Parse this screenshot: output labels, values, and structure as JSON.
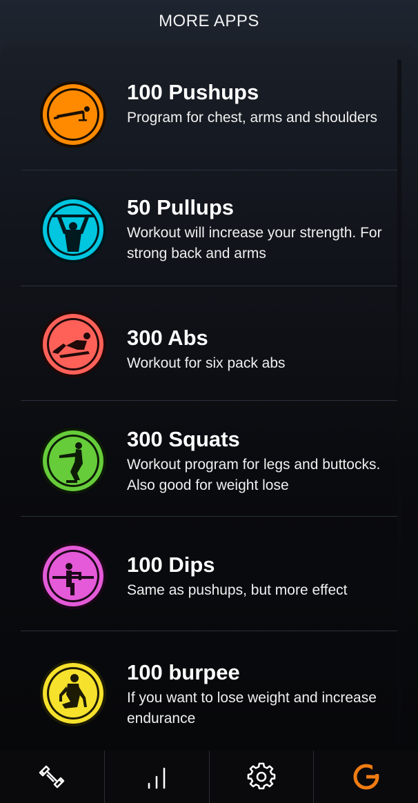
{
  "header": {
    "title": "MORE APPS"
  },
  "apps": [
    {
      "title": "100 Pushups",
      "description": "Program for chest, arms and shoulders",
      "icon": "pushups-icon",
      "color": "#ff8a00"
    },
    {
      "title": "50 Pullups",
      "description": "Workout will increase your strength. For strong back and arms",
      "icon": "pullups-icon",
      "color": "#00c6e0"
    },
    {
      "title": "300 Abs",
      "description": "Workout for six pack abs",
      "icon": "abs-icon",
      "color": "#ff6159"
    },
    {
      "title": "300 Squats",
      "description": "Workout program for legs and buttocks. Also good for weight lose",
      "icon": "squats-icon",
      "color": "#66cc3a"
    },
    {
      "title": "100 Dips",
      "description": "Same as pushups, but more effect",
      "icon": "dips-icon",
      "color": "#e45ad8"
    },
    {
      "title": "100 burpee",
      "description": "If you want to lose weight and increase endurance",
      "icon": "burpee-icon",
      "color": "#f6e12c"
    }
  ],
  "bottom_nav": [
    {
      "icon": "dumbbell-icon",
      "active": false
    },
    {
      "icon": "stats-icon",
      "active": false
    },
    {
      "icon": "gear-icon",
      "active": false
    },
    {
      "icon": "more-apps-logo-icon",
      "active": true,
      "color": "#f07c12"
    }
  ]
}
